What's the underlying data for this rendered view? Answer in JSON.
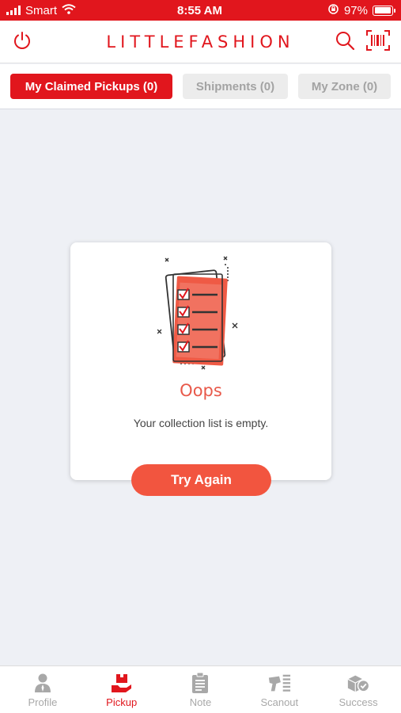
{
  "status_bar": {
    "carrier": "Smart",
    "time": "8:55 AM",
    "battery": "97%",
    "battery_level": 0.97,
    "icons": [
      "signal-icon",
      "wifi-icon",
      "orientation-lock-icon",
      "battery-icon"
    ]
  },
  "header": {
    "brand": "LITTLEFASHION",
    "icons": [
      "power-icon",
      "search-icon",
      "barcode-scan-icon"
    ]
  },
  "tabs": [
    {
      "label": "My Claimed Pickups (0)",
      "active": true
    },
    {
      "label": "Shipments (0)",
      "active": false
    },
    {
      "label": "My Zone (0)",
      "active": false
    }
  ],
  "empty_state": {
    "icon": "checklist-icon",
    "title": "Oops",
    "message": "Your collection list is empty.",
    "button_label": "Try Again"
  },
  "bottom_nav": [
    {
      "label": "Profile",
      "icon": "profile-icon",
      "active": false
    },
    {
      "label": "Pickup",
      "icon": "pickup-icon",
      "active": true
    },
    {
      "label": "Note",
      "icon": "note-icon",
      "active": false
    },
    {
      "label": "Scanout",
      "icon": "scanout-icon",
      "active": false
    },
    {
      "label": "Success",
      "icon": "success-icon",
      "active": false
    }
  ],
  "colors": {
    "brand_red": "#e1161d",
    "button_coral": "#f2553f",
    "background": "#eef0f5",
    "inactive_gray": "#a8a8a8"
  }
}
